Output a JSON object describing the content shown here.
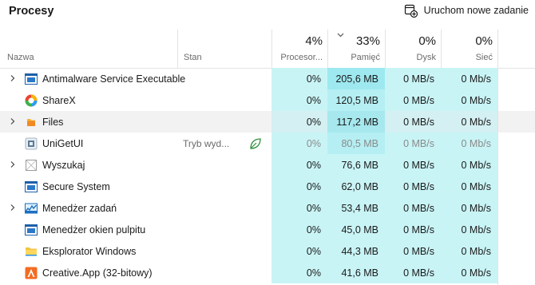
{
  "header": {
    "title": "Procesy",
    "new_task_label": "Uruchom nowe zadanie"
  },
  "columns": {
    "name": "Nazwa",
    "status": "Stan",
    "cpu": {
      "pct": "4%",
      "label": "Procesor..."
    },
    "memory": {
      "pct": "33%",
      "label": "Pamięć"
    },
    "disk": {
      "pct": "0%",
      "label": "Dysk"
    },
    "network": {
      "pct": "0%",
      "label": "Sieć"
    }
  },
  "rows": [
    {
      "name": "Antimalware Service Executable",
      "status": "",
      "cpu": "0%",
      "memory": "205,6 MB",
      "disk": "0 MB/s",
      "network": "0 Mb/s",
      "icon": "antimalware-icon",
      "expandable": true
    },
    {
      "name": "ShareX",
      "status": "",
      "cpu": "0%",
      "memory": "120,5 MB",
      "disk": "0 MB/s",
      "network": "0 Mb/s",
      "icon": "sharex-icon",
      "expandable": false
    },
    {
      "name": "Files",
      "status": "",
      "cpu": "0%",
      "memory": "117,2 MB",
      "disk": "0 MB/s",
      "network": "0 Mb/s",
      "icon": "files-icon",
      "expandable": true
    },
    {
      "name": "UniGetUI",
      "status": "Tryb wyd...",
      "cpu": "0%",
      "memory": "80,5 MB",
      "disk": "0 MB/s",
      "network": "0 Mb/s",
      "icon": "unigetui-icon",
      "expandable": false
    },
    {
      "name": "Wyszukaj",
      "status": "",
      "cpu": "0%",
      "memory": "76,6 MB",
      "disk": "0 MB/s",
      "network": "0 Mb/s",
      "icon": "search-app-icon",
      "expandable": true
    },
    {
      "name": "Secure System",
      "status": "",
      "cpu": "0%",
      "memory": "62,0 MB",
      "disk": "0 MB/s",
      "network": "0 Mb/s",
      "icon": "system-window-icon",
      "expandable": false
    },
    {
      "name": "Menedżer zadań",
      "status": "",
      "cpu": "0%",
      "memory": "53,4 MB",
      "disk": "0 MB/s",
      "network": "0 Mb/s",
      "icon": "task-manager-icon",
      "expandable": true
    },
    {
      "name": "Menedżer okien pulpitu",
      "status": "",
      "cpu": "0%",
      "memory": "45,0 MB",
      "disk": "0 MB/s",
      "network": "0 Mb/s",
      "icon": "system-window-icon",
      "expandable": false
    },
    {
      "name": "Eksplorator Windows",
      "status": "",
      "cpu": "0%",
      "memory": "44,3 MB",
      "disk": "0 MB/s",
      "network": "0 Mb/s",
      "icon": "folder-icon",
      "expandable": false
    },
    {
      "name": "Creative.App (32-bitowy)",
      "status": "",
      "cpu": "0%",
      "memory": "41,6 MB",
      "disk": "0 MB/s",
      "network": "0 Mb/s",
      "icon": "creative-app-icon",
      "expandable": false
    }
  ]
}
